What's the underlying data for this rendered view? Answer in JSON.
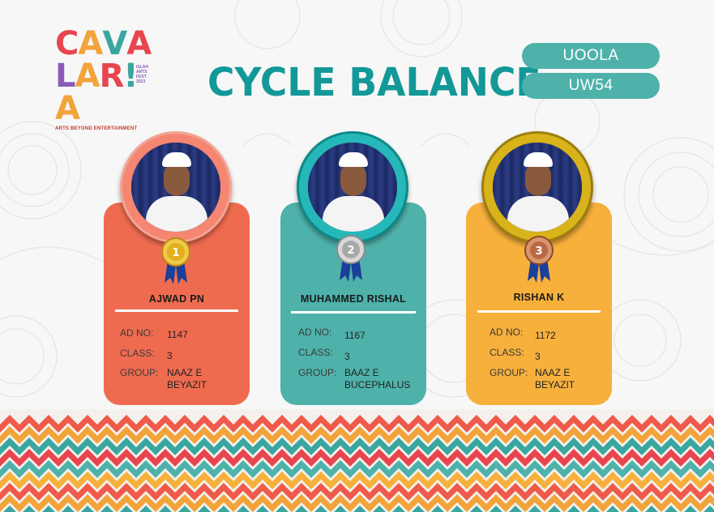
{
  "logo": {
    "row1": [
      "C",
      "A",
      "V",
      "A"
    ],
    "row2": [
      "L",
      "A",
      "R",
      "!",
      "A"
    ],
    "row1_colors": [
      "#e8454f",
      "#f2a33a",
      "#3aa6a0",
      "#e8454f"
    ],
    "row2_colors": [
      "#8a5bb8",
      "#f2a33a",
      "#e8454f",
      "#3aa6a0",
      "#f2a33a"
    ],
    "side": [
      "ISLAH",
      "ARTS",
      "FEST",
      "2023"
    ],
    "tagline": "ARTS BEYOND ENTERTAINMENT"
  },
  "title": "CYCLE BALANCE",
  "tags": [
    "UOOLA",
    "UW54"
  ],
  "labels": {
    "ad_no": "AD NO:",
    "class": "CLASS:",
    "group": "GROUP:"
  },
  "winners": [
    {
      "rank": "1",
      "name": "AJWAD PN",
      "ad_no": "1147",
      "class": "3",
      "group_line1": "NAAZ E",
      "group_line2": "BEYAZIT",
      "medal_color": "#e2b01e"
    },
    {
      "rank": "2",
      "name": "MUHAMMED RISHAL",
      "ad_no": "1167",
      "class": "3",
      "group_line1": "BAAZ E",
      "group_line2": "BUCEPHALUS",
      "medal_color": "#b8b8b8"
    },
    {
      "rank": "3",
      "name": "RISHAN K",
      "ad_no": "1172",
      "class": "3",
      "group_line1": "NAAZ E",
      "group_line2": "BEYAZIT",
      "medal_color": "#b86a45"
    }
  ],
  "colors": {
    "coral": "#ef6b4f",
    "teal": "#4eb2ab",
    "amber": "#f7b03c",
    "title": "#139898",
    "ribbon": "#1b3f9a"
  }
}
